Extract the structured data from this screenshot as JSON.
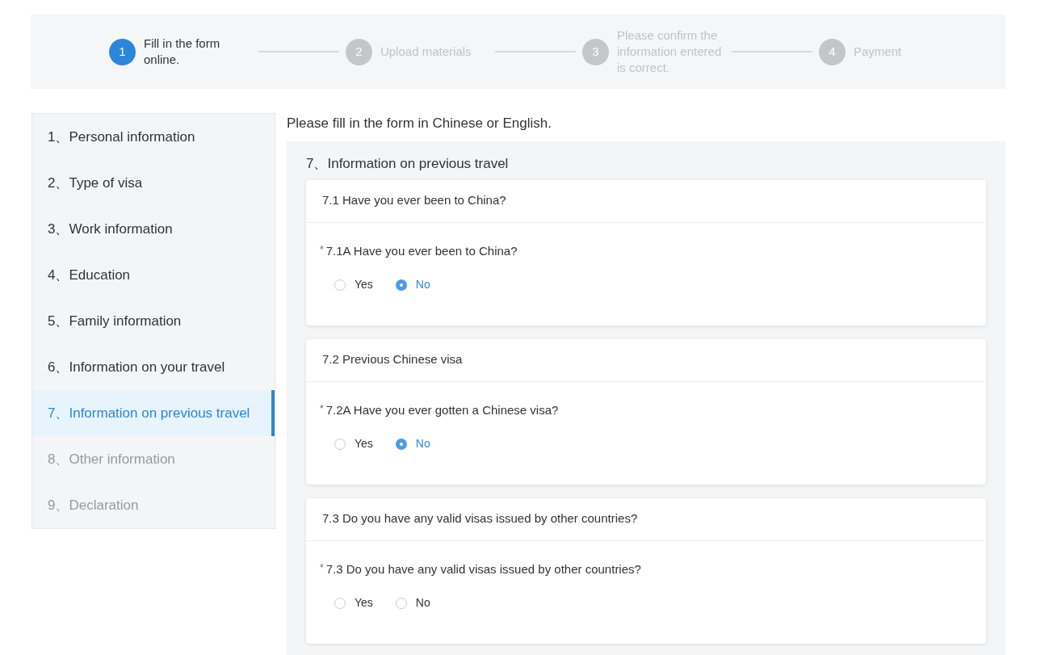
{
  "steps": [
    {
      "number": "1",
      "label": "Fill in the form online.",
      "selected": true
    },
    {
      "number": "2",
      "label": "Upload materials",
      "selected": false
    },
    {
      "number": "3",
      "label": "Please confirm the information entered is correct.",
      "selected": false
    },
    {
      "number": "4",
      "label": "Payment",
      "selected": false
    }
  ],
  "sidebar": {
    "items": [
      {
        "label": "1、Personal information",
        "selected": false,
        "disabled": false
      },
      {
        "label": "2、Type of visa",
        "selected": false,
        "disabled": false
      },
      {
        "label": "3、Work information",
        "selected": false,
        "disabled": false
      },
      {
        "label": "4、Education",
        "selected": false,
        "disabled": false
      },
      {
        "label": "5、Family information",
        "selected": false,
        "disabled": false
      },
      {
        "label": "6、Information on your travel",
        "selected": false,
        "disabled": false
      },
      {
        "label": "7、Information on previous travel",
        "selected": true,
        "disabled": false
      },
      {
        "label": "8、Other information",
        "selected": false,
        "disabled": true
      },
      {
        "label": "9、Declaration",
        "selected": false,
        "disabled": true
      }
    ]
  },
  "intro": "Please fill in the form in Chinese or English.",
  "section": {
    "title": "7、Information on previous travel",
    "cards": [
      {
        "title": "7.1 Have you ever been to China?",
        "required_mark": "*",
        "question": "7.1A Have you ever been to China?",
        "options": [
          {
            "label": "Yes",
            "selected": false
          },
          {
            "label": "No",
            "selected": true
          }
        ]
      },
      {
        "title": "7.2 Previous Chinese visa",
        "required_mark": "*",
        "question": "7.2A Have you ever gotten a Chinese visa?",
        "options": [
          {
            "label": "Yes",
            "selected": false
          },
          {
            "label": "No",
            "selected": true
          }
        ]
      },
      {
        "title": "7.3 Do you have any valid visas issued by other countries?",
        "required_mark": "*",
        "question": "7.3 Do you have any valid visas issued by other countries?",
        "options": [
          {
            "label": "Yes",
            "selected": false
          },
          {
            "label": "No",
            "selected": false
          }
        ]
      }
    ]
  }
}
